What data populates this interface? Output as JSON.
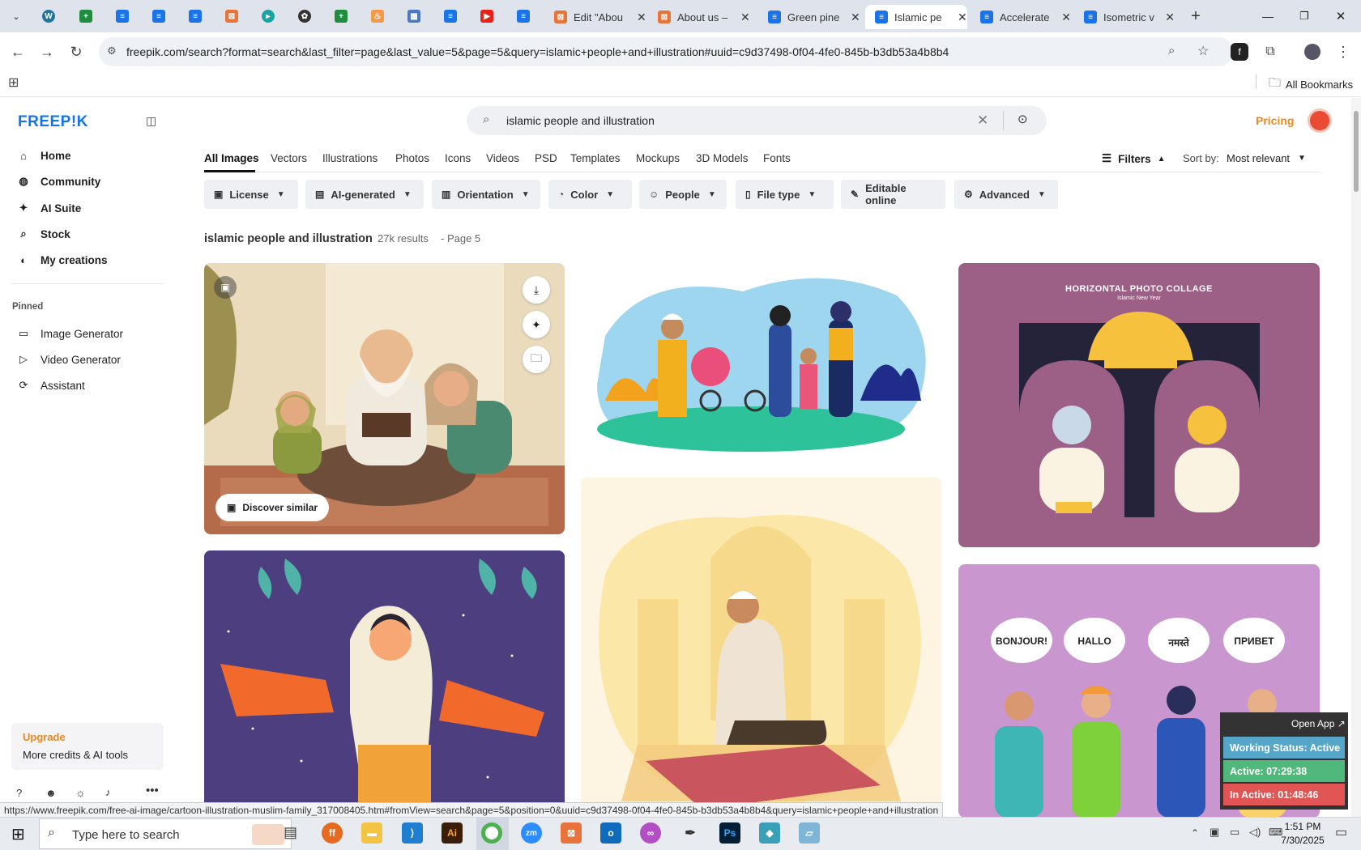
{
  "browser": {
    "tabs": [
      {
        "title": "Edit \"Abou",
        "color": "#e8743b"
      },
      {
        "title": "About us –",
        "color": "#e8743b"
      },
      {
        "title": "Green pine",
        "color": "#1a73e8"
      },
      {
        "title": "Islamic pe",
        "color": "#1a73e8"
      },
      {
        "title": "Accelerate",
        "color": "#1a73e8"
      },
      {
        "title": "Isometric v",
        "color": "#1a73e8"
      }
    ],
    "url": "freepik.com/search?format=search&last_filter=page&last_value=5&page=5&query=islamic+people+and+illustration#uuid=c9d37498-0f04-4fe0-845b-b3db53a4b8b4",
    "bookmarks_label": "All Bookmarks"
  },
  "sidebar": {
    "logo": "FREEP!K",
    "items": [
      {
        "label": "Home",
        "icon": "home-icon",
        "bold": true
      },
      {
        "label": "Community",
        "icon": "globe-icon"
      },
      {
        "label": "AI Suite",
        "icon": "sparkle-icon"
      },
      {
        "label": "Stock",
        "icon": "search-icon"
      },
      {
        "label": "My creations",
        "icon": "circle-icon"
      }
    ],
    "pinned_label": "Pinned",
    "pinned": [
      {
        "label": "Image Generator",
        "icon": "image-icon"
      },
      {
        "label": "Video Generator",
        "icon": "video-icon"
      },
      {
        "label": "Assistant",
        "icon": "assistant-icon"
      }
    ],
    "upgrade": {
      "title": "Upgrade",
      "subtitle": "More credits & AI tools"
    }
  },
  "header": {
    "search_value": "islamic people and illustration",
    "pricing": "Pricing"
  },
  "categories": [
    "All Images",
    "Vectors",
    "Illustrations",
    "Photos",
    "Icons",
    "Videos",
    "PSD",
    "Templates",
    "Mockups",
    "3D Models",
    "Fonts"
  ],
  "filters_label": "Filters",
  "sort": {
    "label": "Sort by:",
    "value": "Most relevant"
  },
  "filter_buttons": [
    "License",
    "AI-generated",
    "Orientation",
    "Color",
    "People",
    "File type",
    "Editable online",
    "Advanced"
  ],
  "results": {
    "query": "islamic people and illustration",
    "count": "27k results",
    "page": "- Page 5"
  },
  "cards": {
    "discover_similar": "Discover similar",
    "collage_title": "HORIZONTAL PHOTO COLLAGE",
    "collage_subtitle": "Islamic New Year",
    "speech": [
      "BONJOUR!",
      "HALLO",
      "नमस्ते",
      "ПРИВЕТ"
    ]
  },
  "status_url": "https://www.freepik.com/free-ai-image/cartoon-illustration-muslim-family_317008405.htm#fromView=search&page=5&position=0&uuid=c9d37498-0f04-4fe0-845b-b3db53a4b8b4&query=islamic+people+and+illustration",
  "working_widget": {
    "open_app": "Open App ↗",
    "status": "Working Status: Active",
    "active": "Active: 07:29:38",
    "inactive": "In Active: 01:48:46"
  },
  "taskbar": {
    "search_placeholder": "Type here to search",
    "time": "1:51 PM",
    "date": "7/30/2025"
  }
}
